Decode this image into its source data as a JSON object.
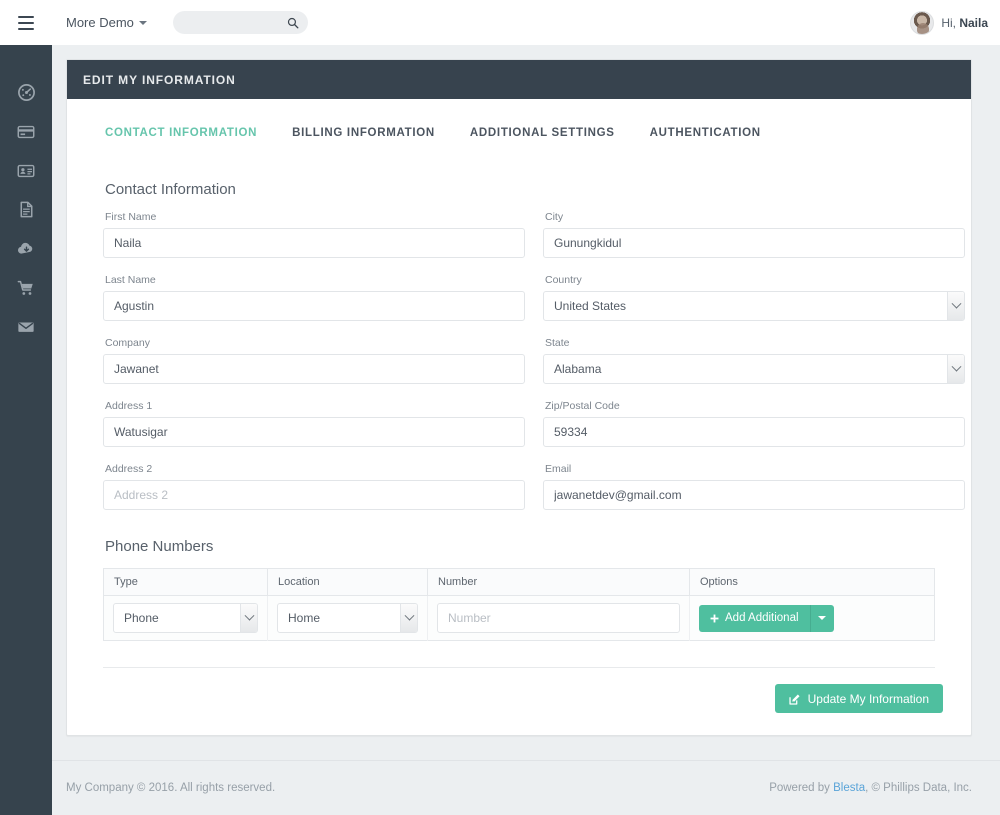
{
  "topbar": {
    "menu_icon": "hamburger-icon",
    "brand_label": "More Demo",
    "search_placeholder": "",
    "search_value": "",
    "search_icon": "search-icon",
    "greeting_prefix": "Hi, ",
    "user_name": "Naila"
  },
  "sidebar": {
    "items": [
      {
        "icon": "dashboard-icon",
        "name": "dashboard"
      },
      {
        "icon": "credit-card-icon",
        "name": "billing"
      },
      {
        "icon": "id-card-icon",
        "name": "accounts"
      },
      {
        "icon": "document-icon",
        "name": "invoices"
      },
      {
        "icon": "cloud-download-icon",
        "name": "downloads"
      },
      {
        "icon": "shopping-cart-icon",
        "name": "order"
      },
      {
        "icon": "envelope-icon",
        "name": "mail"
      }
    ]
  },
  "card": {
    "title": "EDIT MY INFORMATION",
    "tabs": [
      {
        "label": "CONTACT INFORMATION",
        "active": true
      },
      {
        "label": "BILLING INFORMATION",
        "active": false
      },
      {
        "label": "ADDITIONAL SETTINGS",
        "active": false
      },
      {
        "label": "AUTHENTICATION",
        "active": false
      }
    ],
    "contact_section_title": "Contact Information",
    "fields": {
      "first_name": {
        "label": "First Name",
        "value": "Naila",
        "placeholder": "First Name"
      },
      "last_name": {
        "label": "Last Name",
        "value": "Agustin",
        "placeholder": "Last Name"
      },
      "company": {
        "label": "Company",
        "value": "Jawanet",
        "placeholder": "Company"
      },
      "address1": {
        "label": "Address 1",
        "value": "Watusigar",
        "placeholder": "Address 1"
      },
      "address2": {
        "label": "Address 2",
        "value": "",
        "placeholder": "Address 2"
      },
      "city": {
        "label": "City",
        "value": "Gunungkidul",
        "placeholder": "City"
      },
      "country": {
        "label": "Country",
        "value": "United States"
      },
      "state": {
        "label": "State",
        "value": "Alabama"
      },
      "zip": {
        "label": "Zip/Postal Code",
        "value": "59334",
        "placeholder": "Zip/Postal Code"
      },
      "email": {
        "label": "Email",
        "value": "jawanetdev@gmail.com",
        "placeholder": "Email"
      }
    },
    "phone_section_title": "Phone Numbers",
    "phone_table": {
      "headers": [
        "Type",
        "Location",
        "Number",
        "Options"
      ],
      "rows": [
        {
          "type": "Phone",
          "location": "Home",
          "number": "",
          "number_placeholder": "Number",
          "add_label": "Add Additional",
          "add_icon": "plus-icon",
          "toggle_icon": "caret-down-icon"
        }
      ]
    },
    "update_button": {
      "label": "Update My Information",
      "icon": "edit-pencil-icon"
    }
  },
  "footer": {
    "left": "My Company © 2016. All rights reserved.",
    "right_prefix": "Powered by ",
    "right_link": "Blesta",
    "right_suffix": ", © Phillips Data, Inc."
  },
  "colors": {
    "accent_green": "#4fbf9f",
    "header_dark": "#37434e",
    "sidebar_dark": "#36434d",
    "page_bg": "#eceff1",
    "link_blue": "#5aa4d8"
  }
}
